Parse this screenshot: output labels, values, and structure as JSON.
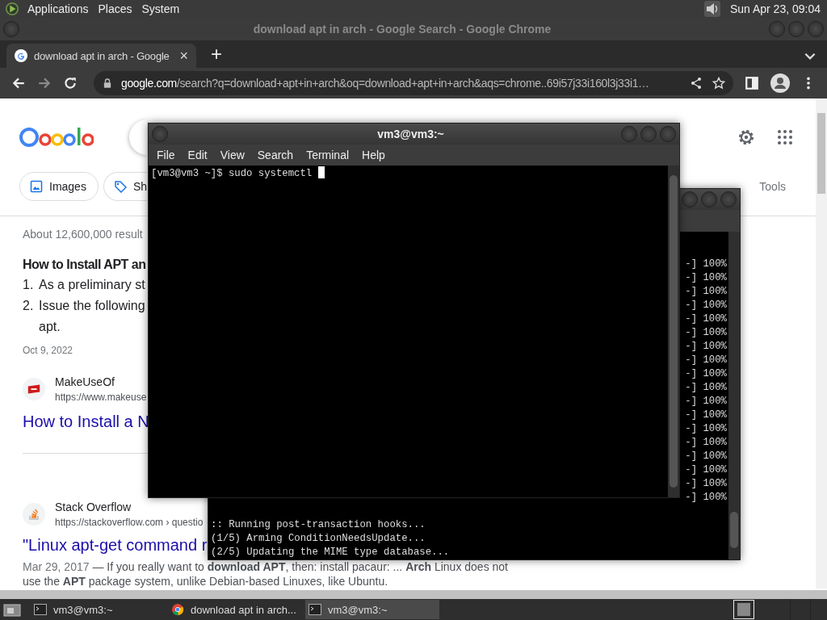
{
  "top_panel": {
    "menus": [
      "Applications",
      "Places",
      "System"
    ],
    "clock": "Sun Apr 23, 09:04"
  },
  "browser": {
    "window_title": "download apt in arch - Google Search - Google Chrome",
    "tab": {
      "title": "download apt in arch - Google",
      "close": "×"
    },
    "new_tab": "+",
    "address": {
      "host": "google.com",
      "path": "/search?q=download+apt+in+arch&oq=download+apt+in+arch&aqs=chrome..69i57j33i160l3j33i1…"
    },
    "page": {
      "chips": [
        "Images",
        "Sh"
      ],
      "tools": "Tools",
      "result_count": "About 12,600,000 result",
      "featured": {
        "heading": "How to Install APT an",
        "steps": [
          {
            "number": "1.",
            "text": "As a preliminary st"
          },
          {
            "number": "2.",
            "text": "Issue the following",
            "continuation": "apt."
          }
        ],
        "date": "Oct 9, 2022"
      },
      "results": [
        {
          "kind": "makeuseof",
          "site": "MakeUseOf",
          "url": "https://www.makeuse",
          "title": "How to Install a N"
        },
        {
          "kind": "stackoverflow",
          "site": "Stack Overflow",
          "url": "https://stackoverflow.com › questio",
          "title": "\"Linux apt-get command r",
          "date": "Mar 29, 2017",
          "snippet": " — If you really want to **download APT**, then: install pacaur: ... **Arch** Linux does not use the **APT** package system, unlike Debian-based Linuxes, like Ubuntu."
        }
      ]
    }
  },
  "back_terminal": {
    "progress_lines": [
      "-] 100%",
      "-] 100%",
      "-] 100%",
      "-] 100%",
      "-] 100%",
      "-] 100%",
      "-] 100%",
      "-] 100%",
      "-] 100%",
      "-] 100%",
      "-] 100%",
      "-] 100%",
      "-] 100%",
      "-] 100%",
      "-] 100%",
      "-] 100%",
      "-] 100%",
      "-] 100%"
    ],
    "lines": [
      ":: Running post-transaction hooks...",
      "(1/5) Arming ConditionNeedsUpdate...",
      "(2/5) Updating the MIME type database..."
    ]
  },
  "front_terminal": {
    "title": "vm3@vm3:~",
    "menus": [
      "File",
      "Edit",
      "View",
      "Search",
      "Terminal",
      "Help"
    ],
    "prompt": "[vm3@vm3 ~]$ sudo systemctl "
  },
  "taskbar": [
    {
      "kind": "terminal",
      "label": "vm3@vm3:~",
      "selected": false
    },
    {
      "kind": "browser",
      "label": "download apt in arch...",
      "selected": false
    },
    {
      "kind": "terminal",
      "label": "vm3@vm3:~",
      "selected": true
    }
  ]
}
